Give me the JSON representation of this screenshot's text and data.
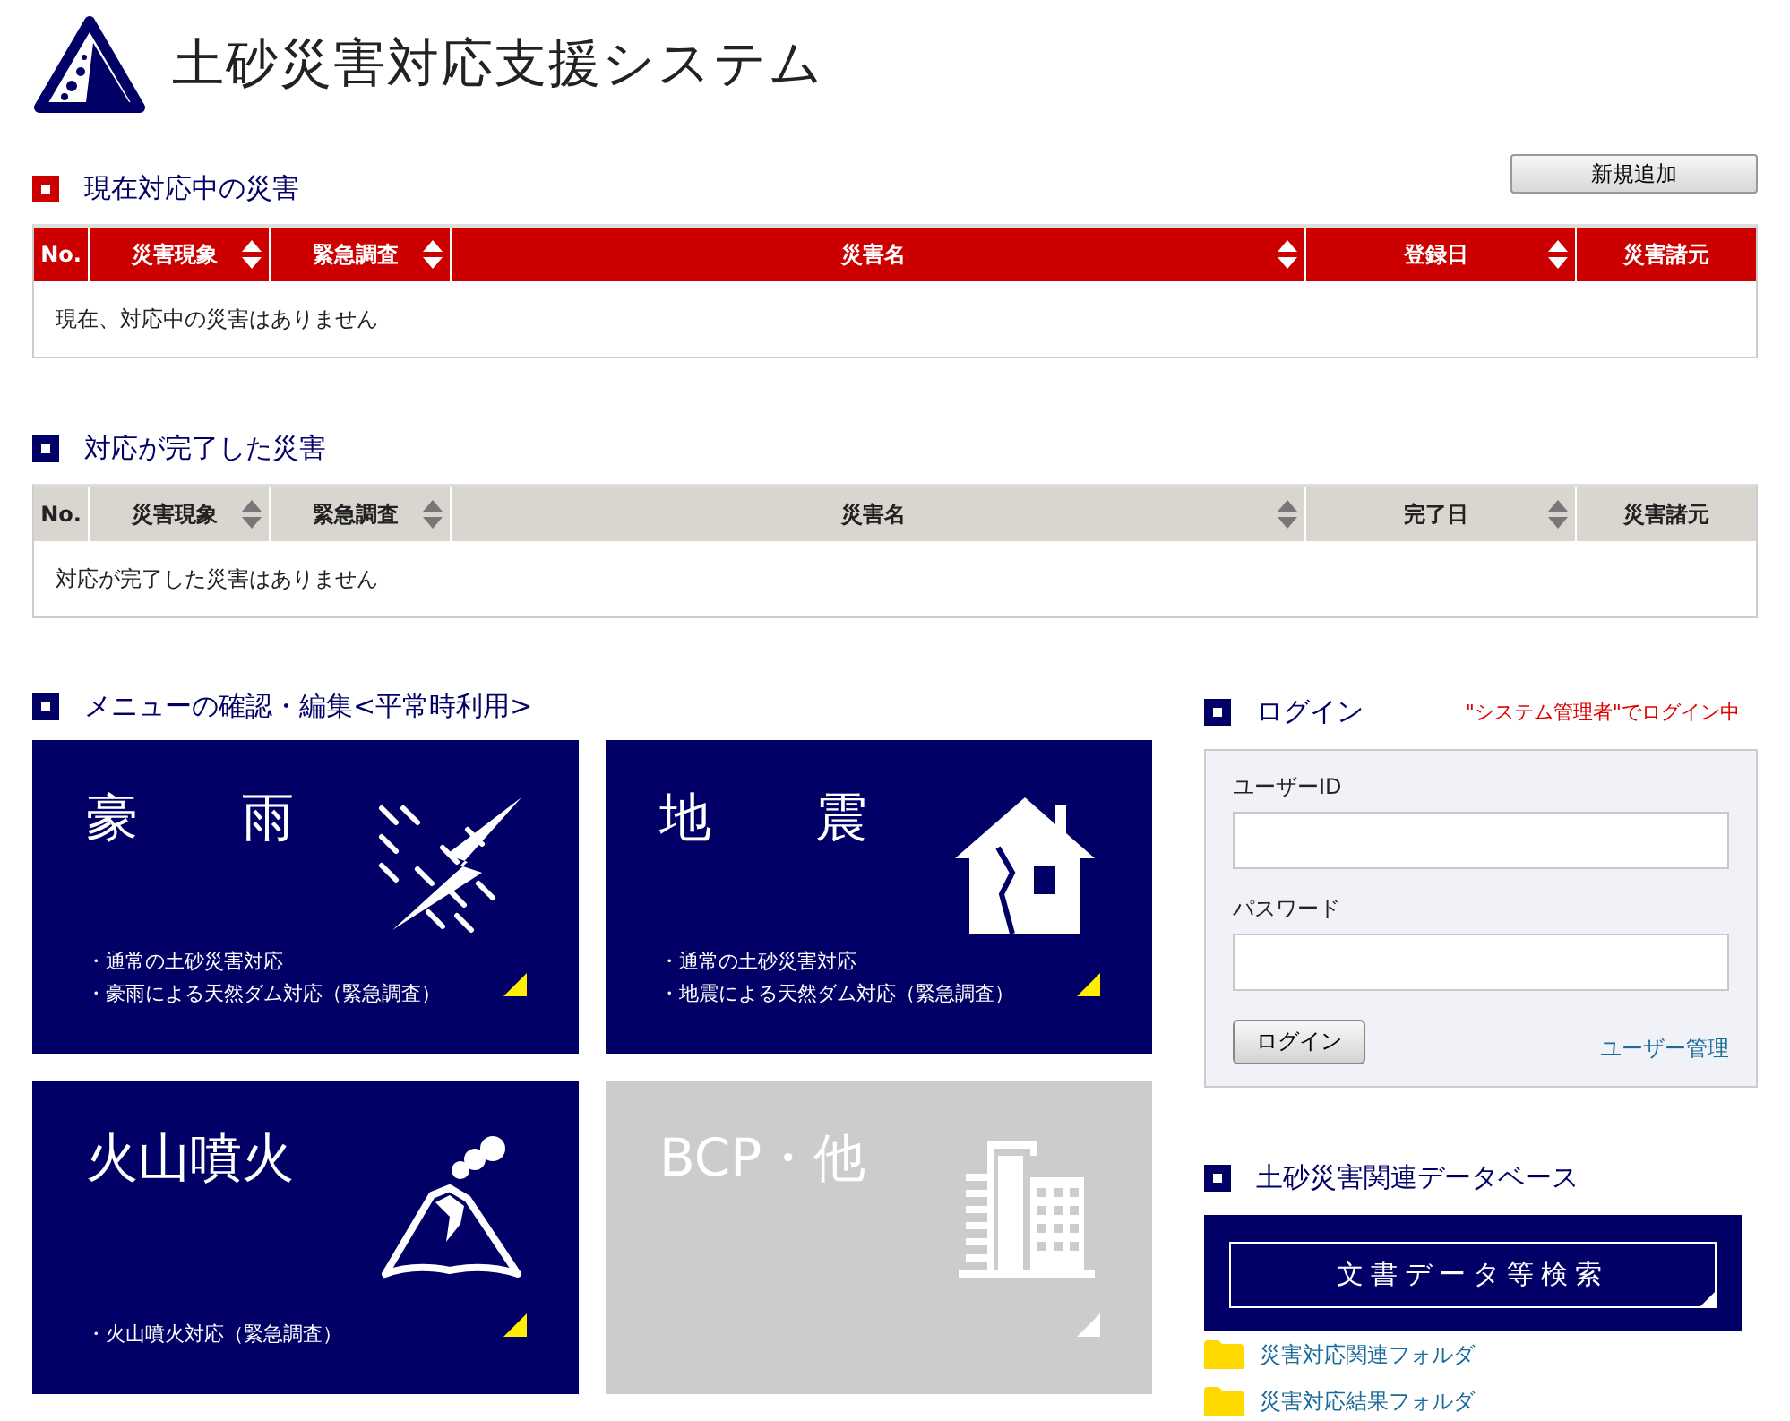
{
  "app_title": "土砂災害対応支援システム",
  "disaster_tables": [
    {
      "kind": "current",
      "title": "現在対応中の災害",
      "action_button": "新規追加",
      "columns": [
        {
          "label": "No.",
          "sortable": false
        },
        {
          "label": "災害現象",
          "sortable": true
        },
        {
          "label": "緊急調査",
          "sortable": true
        },
        {
          "label": "災害名",
          "sortable": true
        },
        {
          "label": "登録日",
          "sortable": true
        },
        {
          "label": "災害諸元",
          "sortable": false
        }
      ],
      "empty_message": "現在、対応中の災害はありません"
    },
    {
      "kind": "completed",
      "title": "対応が完了した災害",
      "columns": [
        {
          "label": "No.",
          "sortable": false
        },
        {
          "label": "災害現象",
          "sortable": true
        },
        {
          "label": "緊急調査",
          "sortable": true
        },
        {
          "label": "災害名",
          "sortable": true
        },
        {
          "label": "完了日",
          "sortable": true
        },
        {
          "label": "災害諸元",
          "sortable": false
        }
      ],
      "empty_message": "対応が完了した災害はありません"
    }
  ],
  "menu": {
    "title": "メニューの確認・編集<平常時利用>",
    "tiles": [
      {
        "kind": "rain",
        "title": "豪　　雨",
        "disabled": false,
        "bullets": [
          "・通常の土砂災害対応",
          "・豪雨による天然ダム対応（緊急調査）"
        ]
      },
      {
        "kind": "earthquake",
        "title": "地　　震",
        "disabled": false,
        "bullets": [
          "・通常の土砂災害対応",
          "・地震による天然ダム対応（緊急調査）"
        ]
      },
      {
        "kind": "volcano",
        "title": "火山噴火",
        "disabled": false,
        "bullets": [
          "・火山噴火対応（緊急調査）"
        ]
      },
      {
        "kind": "building",
        "title": "BCP・他",
        "disabled": true
      }
    ]
  },
  "login": {
    "title": "ログイン",
    "status": "\"システム管理者\"でログイン中",
    "user_id_label": "ユーザーID",
    "password_label": "パスワード",
    "button": "ログイン",
    "admin_link": "ユーザー管理"
  },
  "database": {
    "title": "土砂災害関連データベース",
    "search_button": "文書データ等検索",
    "folders": [
      "災害対応関連フォルダ",
      "災害対応結果フォルダ"
    ]
  }
}
